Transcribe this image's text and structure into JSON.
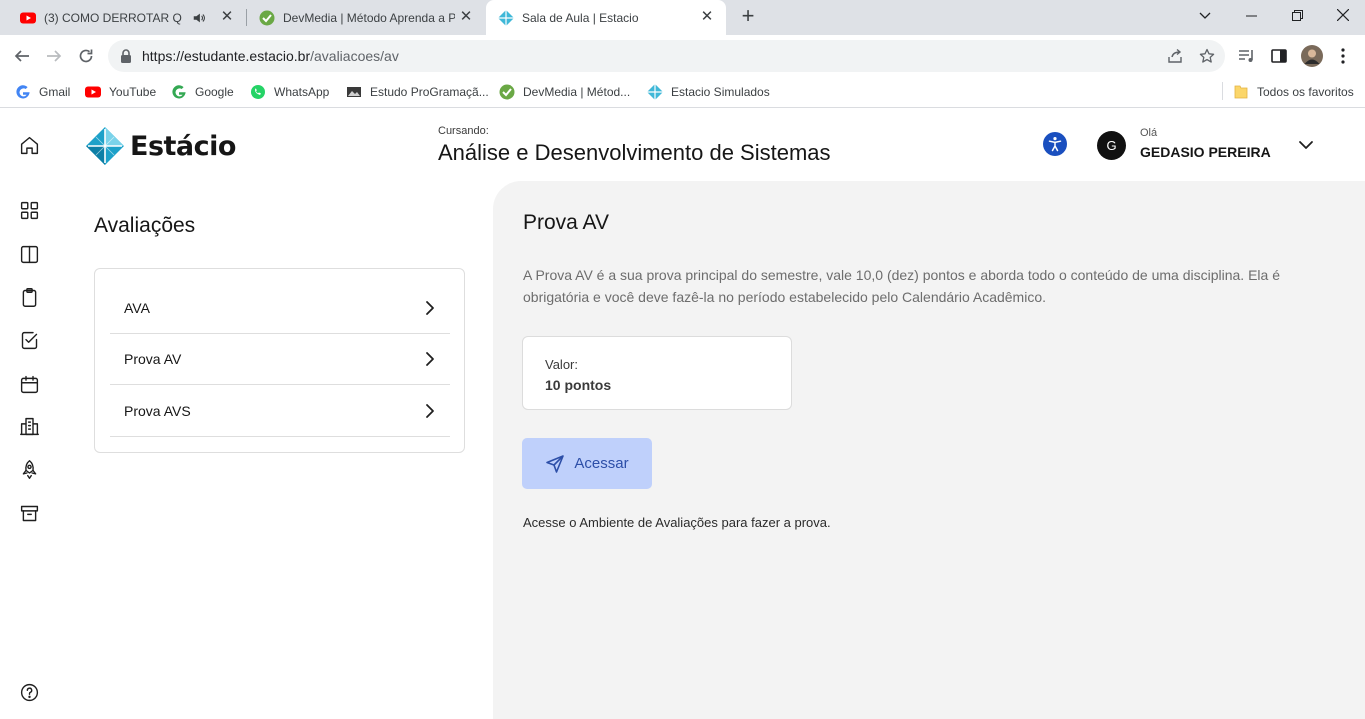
{
  "browser": {
    "tabs": [
      {
        "title": "(3) COMO DERROTAR QUAN",
        "favicon": "youtube-icon"
      },
      {
        "title": "DevMedia | Método Aprenda a P",
        "favicon": "devmedia-icon"
      },
      {
        "title": "Sala de Aula | Estacio",
        "favicon": "estacio-icon",
        "active": true
      }
    ],
    "url_host": "https://estudante.estacio.br",
    "url_path": "/avaliacoes/av",
    "bookmarks": [
      {
        "label": "Gmail",
        "icon": "google-icon"
      },
      {
        "label": "YouTube",
        "icon": "youtube-icon"
      },
      {
        "label": "Google",
        "icon": "google-icon"
      },
      {
        "label": "WhatsApp",
        "icon": "whatsapp-icon"
      },
      {
        "label": "Estudo ProGramaçã...",
        "icon": "image-icon"
      },
      {
        "label": "DevMedia | Métod...",
        "icon": "devmedia-icon"
      },
      {
        "label": "Estacio Simulados",
        "icon": "estacio-icon"
      }
    ],
    "all_bookmarks": "Todos os favoritos"
  },
  "header": {
    "brand": "Estácio",
    "course_label": "Cursando:",
    "course_name": "Análise e Desenvolvimento de Sistemas",
    "greeting": "Olá",
    "user_name": "GEDASIO PEREIRA",
    "avatar_initial": "G"
  },
  "sidebar": {
    "title": "Avaliações",
    "items": [
      {
        "label": "AVA"
      },
      {
        "label": "Prova AV"
      },
      {
        "label": "Prova AVS"
      }
    ]
  },
  "main": {
    "title": "Prova AV",
    "description": "A Prova AV é a sua prova principal do semestre, vale 10,0 (dez) pontos e aborda todo o conteúdo de uma disciplina. Ela é obrigatória e você deve fazê-la no período estabelecido pelo Calendário Acadêmico.",
    "value_label": "Valor:",
    "value": "10 pontos",
    "button_label": "Acessar",
    "hint": "Acesse o Ambiente de Avaliações para fazer a prova."
  },
  "colors": {
    "accent_button_bg": "#bfd0fb",
    "accent_button_text": "#2d4fa8",
    "accessibility_blue": "#1a4fbf",
    "content_bg": "#f3f3f3"
  }
}
